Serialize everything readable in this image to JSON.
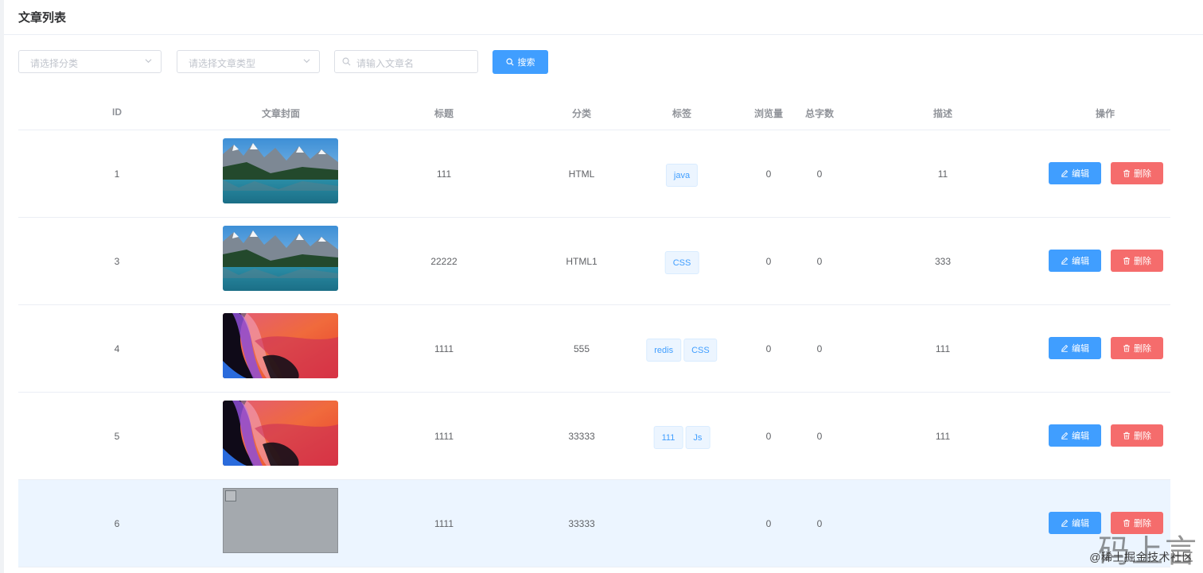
{
  "page": {
    "title": "文章列表"
  },
  "filters": {
    "category_placeholder": "请选择分类",
    "type_placeholder": "请选择文章类型",
    "name_placeholder": "请输入文章名",
    "search_label": "搜索"
  },
  "table": {
    "headers": {
      "id": "ID",
      "cover": "文章封面",
      "title": "标题",
      "category": "分类",
      "tags": "标签",
      "views": "浏览量",
      "words": "总字数",
      "description": "描述",
      "actions": "操作"
    },
    "rows": [
      {
        "id": "1",
        "cover": "mountain-lake",
        "title": "111",
        "category": "HTML",
        "tags": [
          "java"
        ],
        "views": "0",
        "words": "0",
        "description": "11"
      },
      {
        "id": "3",
        "cover": "mountain-lake",
        "title": "22222",
        "category": "HTML1",
        "tags": [
          "CSS"
        ],
        "views": "0",
        "words": "0",
        "description": "333"
      },
      {
        "id": "4",
        "cover": "abstract-wave",
        "title": "1111",
        "category": "555",
        "tags": [
          "redis",
          "CSS"
        ],
        "views": "0",
        "words": "0",
        "description": "111"
      },
      {
        "id": "5",
        "cover": "abstract-wave",
        "title": "1111",
        "category": "33333",
        "tags": [
          "111",
          "Js"
        ],
        "views": "0",
        "words": "0",
        "description": "111"
      },
      {
        "id": "6",
        "cover": "broken-image",
        "title": "1111",
        "category": "33333",
        "tags": [],
        "views": "0",
        "words": "0",
        "description": ""
      }
    ],
    "edit_label": "编辑",
    "delete_label": "删除"
  },
  "watermark": {
    "text": "@稀土掘金技术社区",
    "brand": "码上言"
  },
  "colors": {
    "primary": "#409eff",
    "danger": "#f56c6c",
    "tag_bg": "#ecf5ff",
    "row_highlight": "#ecf5ff"
  }
}
